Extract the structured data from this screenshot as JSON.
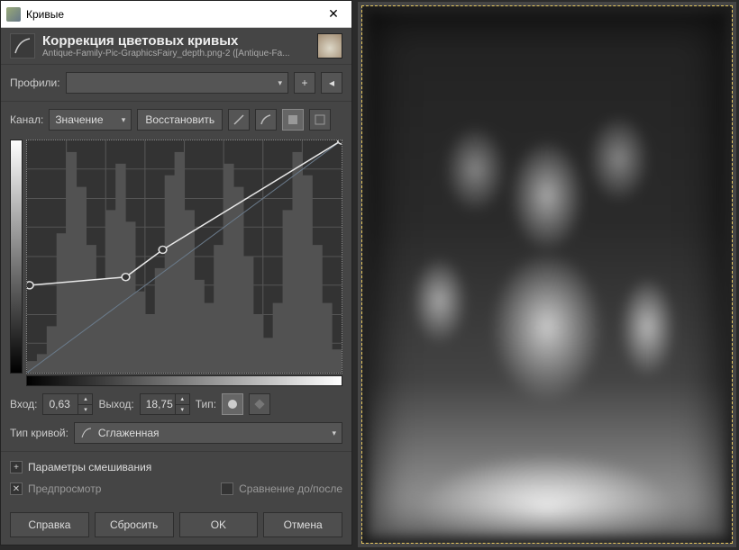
{
  "window": {
    "title": "Кривые",
    "header_title": "Коррекция цветовых кривых",
    "file_name": "Antique-Family-Pic-GraphicsFairy_depth.png-2 ([Antique-Fa..."
  },
  "profiles": {
    "label": "Профили:",
    "value": ""
  },
  "channel": {
    "label": "Канал:",
    "value": "Значение",
    "reset_button": "Восстановить"
  },
  "io": {
    "input_label": "Вход:",
    "input_value": "0,63",
    "output_label": "Выход:",
    "output_value": "18,75",
    "type_label": "Тип:"
  },
  "curve_type": {
    "label": "Тип кривой:",
    "value": "Сглаженная"
  },
  "blend_options": "Параметры смешивания",
  "preview": {
    "label": "Предпросмотр",
    "compare": "Сравнение до/после"
  },
  "actions": {
    "help": "Справка",
    "reset": "Сбросить",
    "ok": "OK",
    "cancel": "Отмена"
  },
  "chart_data": {
    "type": "line",
    "title": "",
    "xlabel": "",
    "ylabel": "",
    "xlim": [
      0,
      255
    ],
    "ylim": [
      0,
      255
    ],
    "series": [
      {
        "name": "curve",
        "x": [
          0,
          2,
          80,
          110,
          255
        ],
        "values": [
          96,
          96,
          105,
          135,
          255
        ]
      },
      {
        "name": "identity",
        "x": [
          0,
          255
        ],
        "values": [
          0,
          255
        ]
      }
    ],
    "control_points": [
      {
        "x": 2,
        "y": 96
      },
      {
        "x": 80,
        "y": 105
      },
      {
        "x": 110,
        "y": 135
      },
      {
        "x": 255,
        "y": 255
      }
    ],
    "histogram": [
      5,
      8,
      20,
      60,
      95,
      80,
      55,
      40,
      70,
      90,
      65,
      35,
      25,
      45,
      85,
      95,
      70,
      40,
      30,
      55,
      90,
      80,
      50,
      25,
      15,
      30,
      70,
      95,
      85,
      55,
      30,
      10
    ]
  }
}
